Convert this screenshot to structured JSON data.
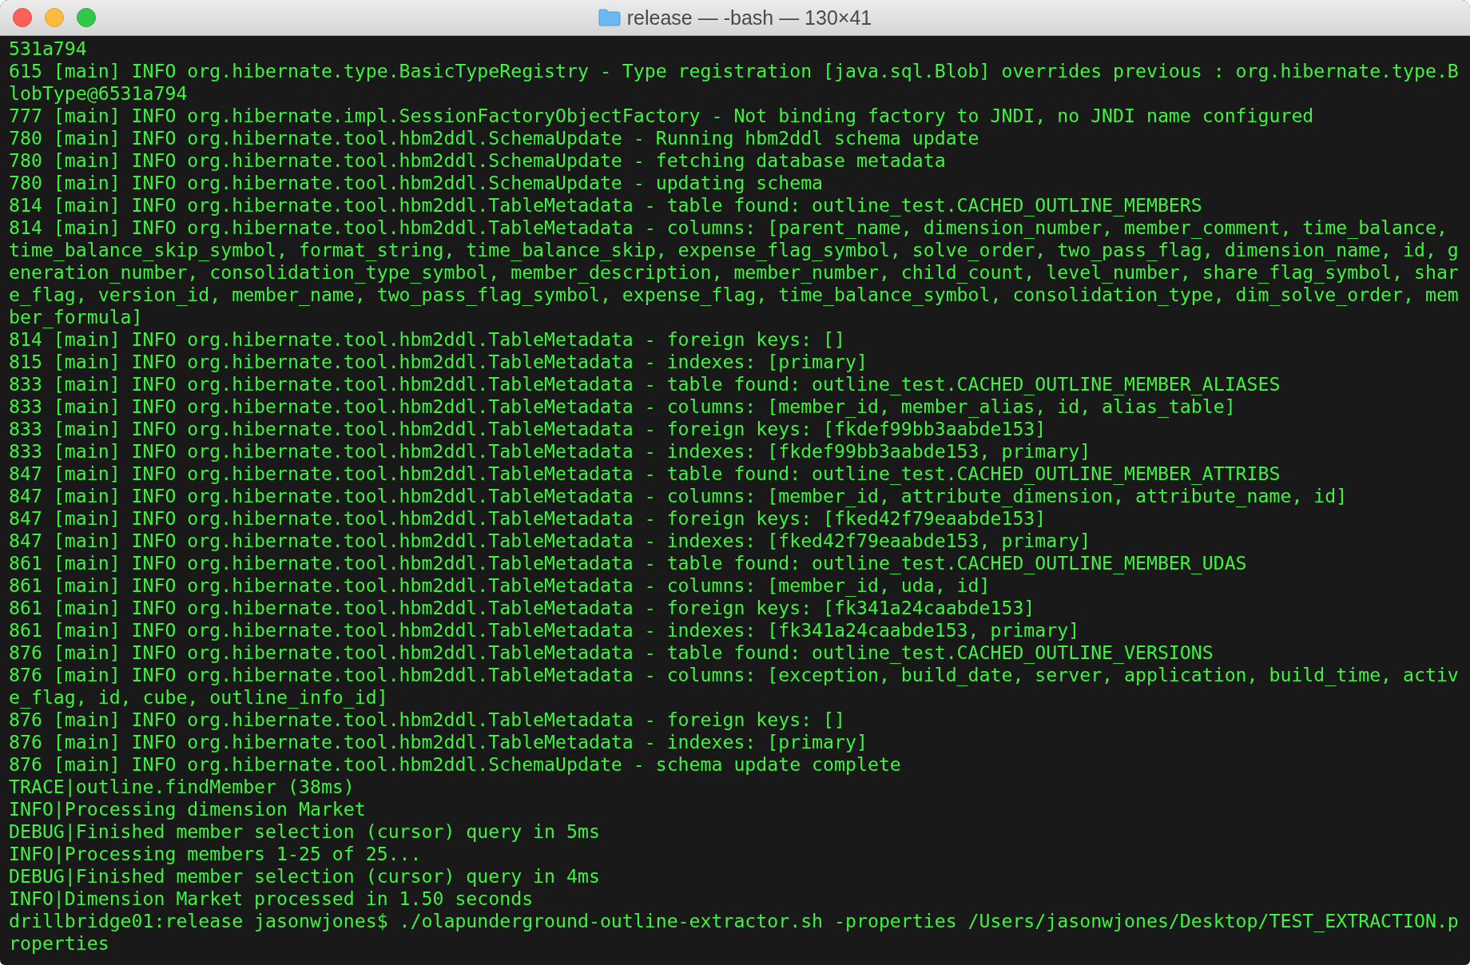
{
  "window": {
    "title": "release — -bash — 130×41"
  },
  "terminal": {
    "lines": [
      "531a794",
      "615 [main] INFO org.hibernate.type.BasicTypeRegistry - Type registration [java.sql.Blob] overrides previous : org.hibernate.type.B",
      "lobType@6531a794",
      "777 [main] INFO org.hibernate.impl.SessionFactoryObjectFactory - Not binding factory to JNDI, no JNDI name configured",
      "780 [main] INFO org.hibernate.tool.hbm2ddl.SchemaUpdate - Running hbm2ddl schema update",
      "780 [main] INFO org.hibernate.tool.hbm2ddl.SchemaUpdate - fetching database metadata",
      "780 [main] INFO org.hibernate.tool.hbm2ddl.SchemaUpdate - updating schema",
      "814 [main] INFO org.hibernate.tool.hbm2ddl.TableMetadata - table found: outline_test.CACHED_OUTLINE_MEMBERS",
      "814 [main] INFO org.hibernate.tool.hbm2ddl.TableMetadata - columns: [parent_name, dimension_number, member_comment, time_balance,",
      "time_balance_skip_symbol, format_string, time_balance_skip, expense_flag_symbol, solve_order, two_pass_flag, dimension_name, id, g",
      "eneration_number, consolidation_type_symbol, member_description, member_number, child_count, level_number, share_flag_symbol, shar",
      "e_flag, version_id, member_name, two_pass_flag_symbol, expense_flag, time_balance_symbol, consolidation_type, dim_solve_order, mem",
      "ber_formula]",
      "814 [main] INFO org.hibernate.tool.hbm2ddl.TableMetadata - foreign keys: []",
      "815 [main] INFO org.hibernate.tool.hbm2ddl.TableMetadata - indexes: [primary]",
      "833 [main] INFO org.hibernate.tool.hbm2ddl.TableMetadata - table found: outline_test.CACHED_OUTLINE_MEMBER_ALIASES",
      "833 [main] INFO org.hibernate.tool.hbm2ddl.TableMetadata - columns: [member_id, member_alias, id, alias_table]",
      "833 [main] INFO org.hibernate.tool.hbm2ddl.TableMetadata - foreign keys: [fkdef99bb3aabde153]",
      "833 [main] INFO org.hibernate.tool.hbm2ddl.TableMetadata - indexes: [fkdef99bb3aabde153, primary]",
      "847 [main] INFO org.hibernate.tool.hbm2ddl.TableMetadata - table found: outline_test.CACHED_OUTLINE_MEMBER_ATTRIBS",
      "847 [main] INFO org.hibernate.tool.hbm2ddl.TableMetadata - columns: [member_id, attribute_dimension, attribute_name, id]",
      "847 [main] INFO org.hibernate.tool.hbm2ddl.TableMetadata - foreign keys: [fked42f79eaabde153]",
      "847 [main] INFO org.hibernate.tool.hbm2ddl.TableMetadata - indexes: [fked42f79eaabde153, primary]",
      "861 [main] INFO org.hibernate.tool.hbm2ddl.TableMetadata - table found: outline_test.CACHED_OUTLINE_MEMBER_UDAS",
      "861 [main] INFO org.hibernate.tool.hbm2ddl.TableMetadata - columns: [member_id, uda, id]",
      "861 [main] INFO org.hibernate.tool.hbm2ddl.TableMetadata - foreign keys: [fk341a24caabde153]",
      "861 [main] INFO org.hibernate.tool.hbm2ddl.TableMetadata - indexes: [fk341a24caabde153, primary]",
      "876 [main] INFO org.hibernate.tool.hbm2ddl.TableMetadata - table found: outline_test.CACHED_OUTLINE_VERSIONS",
      "876 [main] INFO org.hibernate.tool.hbm2ddl.TableMetadata - columns: [exception, build_date, server, application, build_time, activ",
      "e_flag, id, cube, outline_info_id]",
      "876 [main] INFO org.hibernate.tool.hbm2ddl.TableMetadata - foreign keys: []",
      "876 [main] INFO org.hibernate.tool.hbm2ddl.TableMetadata - indexes: [primary]",
      "876 [main] INFO org.hibernate.tool.hbm2ddl.SchemaUpdate - schema update complete",
      "TRACE|outline.findMember (38ms)",
      "INFO|Processing dimension Market",
      "DEBUG|Finished member selection (cursor) query in 5ms",
      "INFO|Processing members 1-25 of 25...",
      "DEBUG|Finished member selection (cursor) query in 4ms",
      "INFO|Dimension Market processed in 1.50 seconds",
      "drillbridge01:release jasonwjones$ ./olapunderground-outline-extractor.sh -properties /Users/jasonwjones/Desktop/TEST_EXTRACTION.p",
      "roperties"
    ]
  }
}
